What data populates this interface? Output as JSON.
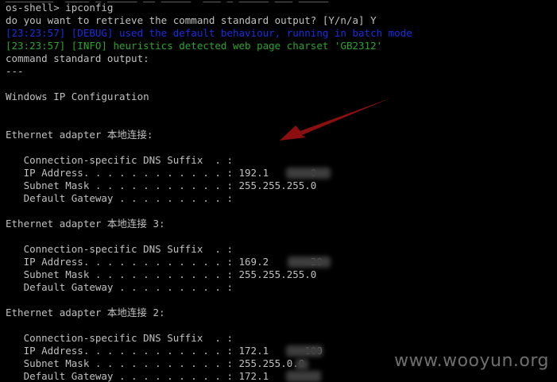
{
  "colors": {
    "background": "#000000",
    "text": "#c0c0c0",
    "debug": "#1a2ee0",
    "info": "#2aa52a",
    "arrow": "#8b0f0f"
  },
  "terminal": {
    "prompt": "os-shell> ipconfig",
    "question": "do you want to retrieve the command standard output? [Y/n/a] Y",
    "debug": "[23:23:57] [DEBUG] used the default behaviour, running in batch mode",
    "info": "[23:23:57] [INFO] heuristics detected web page charset 'GB2312'",
    "output_header": "command standard output:",
    "separator": "---",
    "ip_config_title": "Windows IP Configuration",
    "adapters": [
      {
        "title": "Ethernet adapter 本地连接:",
        "dns_suffix": "   Connection-specific DNS Suffix  . :",
        "ip": "   IP Address. . . . . . . . . . . . : 192.1       0",
        "mask": "   Subnet Mask . . . . . . . . . . . : 255.255.255.0",
        "gateway": "   Default Gateway . . . . . . . . . :"
      },
      {
        "title": "Ethernet adapter 本地连接 3:",
        "dns_suffix": "   Connection-specific DNS Suffix  . :",
        "ip": "   IP Address. . . . . . . . . . . . : 169.2       20",
        "mask": "   Subnet Mask . . . . . . . . . . . : 255.255.255.0",
        "gateway": "   Default Gateway . . . . . . . . . :"
      },
      {
        "title": "Ethernet adapter 本地连接 2:",
        "dns_suffix": "   Connection-specific DNS Suffix  . :",
        "ip": "   IP Address. . . . . . . . . . . . : 172.1      100",
        "mask": "   Subnet Mask . . . . . . . . . . . : 255.255.0.0",
        "gateway": "   Default Gateway . . . . . . . . . : 172.1"
      }
    ]
  },
  "watermark": "www.wooyun.org"
}
